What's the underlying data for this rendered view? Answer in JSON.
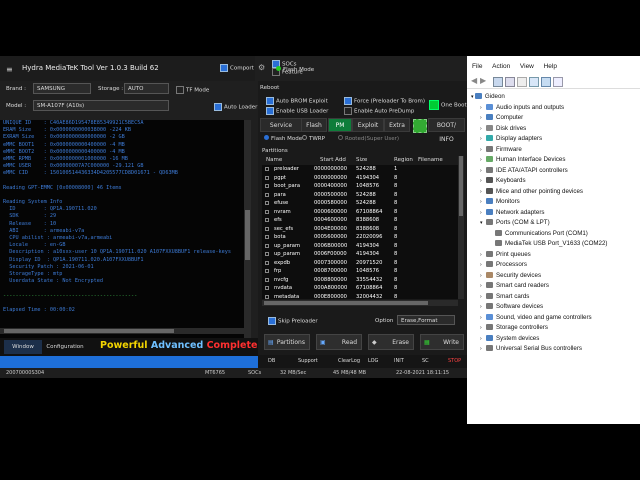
{
  "hydra": {
    "title": "Hydra MediaTeK Tool  Ver 1.0.3 Build 62",
    "menu_glyph": "≡",
    "top_checks": {
      "comport": "Comport",
      "socs": "SOCs",
      "feature": "Feature"
    },
    "flash_mode": "Flash Mode",
    "brand_label": "Brand :",
    "brand_value": "SAMSUNG",
    "storage_label": "Storage :",
    "storage_value": "AUTO",
    "tf_mode": "TF Mode",
    "model_label": "Model :",
    "model_value": "SM-A107F (A10s)",
    "auto_loader": "Auto Loader",
    "console_lines": [
      {
        "t": "UNIQUE ID    : C40AE86D195478E85349921C5BEC5A",
        "c": ""
      },
      {
        "t": "ERAM Size    : 0x0000000000038000 -224 KB",
        "c": ""
      },
      {
        "t": "EXRAM Size   : 0x0000000080000000 -2 GB",
        "c": ""
      },
      {
        "t": "eMMC BOOT1   : 0x0000000000400000 -4 MB",
        "c": ""
      },
      {
        "t": "eMMC BOOT2   : 0x0000000000400000 -4 MB",
        "c": ""
      },
      {
        "t": "eMMC RPMB    : 0x0000000001000000 -16 MB",
        "c": ""
      },
      {
        "t": "eMMC USER    : 0x00000007A7C000000 -29.121 GB",
        "c": ""
      },
      {
        "t": "eMMC CID     : 150100514436334D4205577CD8D01671 - QD63MB",
        "c": ""
      },
      {
        "t": "",
        "c": ""
      },
      {
        "t": "Reading GPT-EMMC [0x00008000] 46 Items",
        "c": ""
      },
      {
        "t": "",
        "c": ""
      },
      {
        "t": "Reading System Info",
        "c": ""
      },
      {
        "t": "  ID         : QP1A.190711.020",
        "c": ""
      },
      {
        "t": "  SDK        : 29",
        "c": ""
      },
      {
        "t": "  Release    : 10",
        "c": ""
      },
      {
        "t": "  ABI        : armeabi-v7a",
        "c": ""
      },
      {
        "t": "  CPU abilist : armeabi-v7a,armeabi",
        "c": ""
      },
      {
        "t": "  Locale     : en-GB",
        "c": ""
      },
      {
        "t": "  Description : a10sxx-user 10 QP1A.190711.020 A107FXXU8BUF1 release-keys",
        "c": ""
      },
      {
        "t": "  Display ID  : QP1A.190711.020.A107FXXU8BUF1",
        "c": ""
      },
      {
        "t": "  Security Patch : 2021-06-01",
        "c": ""
      },
      {
        "t": "  StorageType : mtp",
        "c": ""
      },
      {
        "t": "  Userdata State : Not Encrypted",
        "c": ""
      },
      {
        "t": "",
        "c": ""
      },
      {
        "t": "-------------------------------------------",
        "c": "g"
      },
      {
        "t": "",
        "c": ""
      },
      {
        "t": "Elapsed Time : 00:00:02",
        "c": ""
      }
    ],
    "bottom_tabs": {
      "window": "Window",
      "configuration": "Configuration"
    },
    "banner": {
      "powerful": "Powerful",
      "advanced": "Advanced",
      "complete": "Complete"
    },
    "reboot_label": "Reboot",
    "right_checks": {
      "auto_brom": "Auto BROM Exploit",
      "force_preloader": "Force (Preloader To Brom)",
      "enable_usb": "Enable USB Loader",
      "enable_auto_predump": "Enable Auto PreDump",
      "one_boot": "One Boot"
    },
    "tabs": [
      "Service",
      "Flash",
      "PM",
      "Exploit",
      "Extra",
      "BOOT/ INFO"
    ],
    "radio": {
      "flash_mode": "Flash Mode",
      "twrp": "TWRP",
      "rooted": "Rooted(Super User)"
    },
    "partitions_title": "Partitions",
    "table_headers": {
      "name": "Name",
      "start": "Start Add",
      "size": "Size",
      "region": "Region",
      "filename": "Filename"
    },
    "partitions": [
      {
        "name": "preloader",
        "start": "0000000000",
        "size": "524288",
        "region": "1"
      },
      {
        "name": "pgpt",
        "start": "0000000000",
        "size": "4194304",
        "region": "8"
      },
      {
        "name": "boot_para",
        "start": "0000400000",
        "size": "1048576",
        "region": "8"
      },
      {
        "name": "para",
        "start": "0000500000",
        "size": "524288",
        "region": "8"
      },
      {
        "name": "efuse",
        "start": "0000580000",
        "size": "524288",
        "region": "8"
      },
      {
        "name": "nvram",
        "start": "0000600000",
        "size": "67108864",
        "region": "8"
      },
      {
        "name": "efs",
        "start": "0004600000",
        "size": "8388608",
        "region": "8"
      },
      {
        "name": "sec_efs",
        "start": "0004E00000",
        "size": "8388608",
        "region": "8"
      },
      {
        "name": "bota",
        "start": "0005600000",
        "size": "22020096",
        "region": "8"
      },
      {
        "name": "up_param",
        "start": "0006B00000",
        "size": "4194304",
        "region": "8"
      },
      {
        "name": "up_param",
        "start": "0006F00000",
        "size": "4194304",
        "region": "8"
      },
      {
        "name": "expdb",
        "start": "0007300000",
        "size": "20971520",
        "region": "8"
      },
      {
        "name": "frp",
        "start": "0008700000",
        "size": "1048576",
        "region": "8"
      },
      {
        "name": "nvcfg",
        "start": "0008800000",
        "size": "33554432",
        "region": "8"
      },
      {
        "name": "nvdata",
        "start": "000A800000",
        "size": "67108864",
        "region": "8"
      },
      {
        "name": "metadata",
        "start": "000E800000",
        "size": "32004432",
        "region": "8"
      }
    ],
    "skip_preloader": "Skip Preloader",
    "option_label": "Option",
    "option_value": "Erase,Format",
    "actions": [
      "Partitions",
      "Read",
      "Erase",
      "Write"
    ],
    "status_items": [
      "DB",
      "Support",
      "ClearLog",
      "LOG",
      "INIT",
      "SC",
      "STOP"
    ],
    "bottom_status": {
      "left": "20070000S304",
      "chip": "MT6765",
      "speed": "32 MB/Sec",
      "socs": "SOCs",
      "data": "45 MB/48 MB",
      "date": "22-08-2021 18:11:15"
    }
  },
  "device_manager": {
    "menu": [
      "File",
      "Action",
      "View",
      "Help"
    ],
    "root": "Gideon",
    "items": [
      {
        "label": "Audio inputs and outputs",
        "indent": 1,
        "color": "#5a8fd6"
      },
      {
        "label": "Computer",
        "indent": 1,
        "color": "#4a7fc0"
      },
      {
        "label": "Disk drives",
        "indent": 1,
        "color": "#888"
      },
      {
        "label": "Display adapters",
        "indent": 1,
        "color": "#3aa"
      },
      {
        "label": "Firmware",
        "indent": 1,
        "color": "#777"
      },
      {
        "label": "Human Interface Devices",
        "indent": 1,
        "color": "#6a6"
      },
      {
        "label": "IDE ATA/ATAPI controllers",
        "indent": 1,
        "color": "#777"
      },
      {
        "label": "Keyboards",
        "indent": 1,
        "color": "#555"
      },
      {
        "label": "Mice and other pointing devices",
        "indent": 1,
        "color": "#555"
      },
      {
        "label": "Monitors",
        "indent": 1,
        "color": "#4a7fc0"
      },
      {
        "label": "Network adapters",
        "indent": 1,
        "color": "#4a7fc0"
      },
      {
        "label": "Ports (COM & LPT)",
        "indent": 1,
        "color": "#777",
        "open": true
      },
      {
        "label": "Communications Port (COM1)",
        "indent": 2,
        "color": "#777"
      },
      {
        "label": "MediaTek USB Port_V1633 (COM22)",
        "indent": 2,
        "color": "#777"
      },
      {
        "label": "Print queues",
        "indent": 1,
        "color": "#777"
      },
      {
        "label": "Processors",
        "indent": 1,
        "color": "#777"
      },
      {
        "label": "Security devices",
        "indent": 1,
        "color": "#a86"
      },
      {
        "label": "Smart card readers",
        "indent": 1,
        "color": "#777"
      },
      {
        "label": "Smart cards",
        "indent": 1,
        "color": "#777"
      },
      {
        "label": "Software devices",
        "indent": 1,
        "color": "#777"
      },
      {
        "label": "Sound, video and game controllers",
        "indent": 1,
        "color": "#5a8fd6"
      },
      {
        "label": "Storage controllers",
        "indent": 1,
        "color": "#777"
      },
      {
        "label": "System devices",
        "indent": 1,
        "color": "#4a7fc0"
      },
      {
        "label": "Universal Serial Bus controllers",
        "indent": 1,
        "color": "#777"
      }
    ]
  }
}
